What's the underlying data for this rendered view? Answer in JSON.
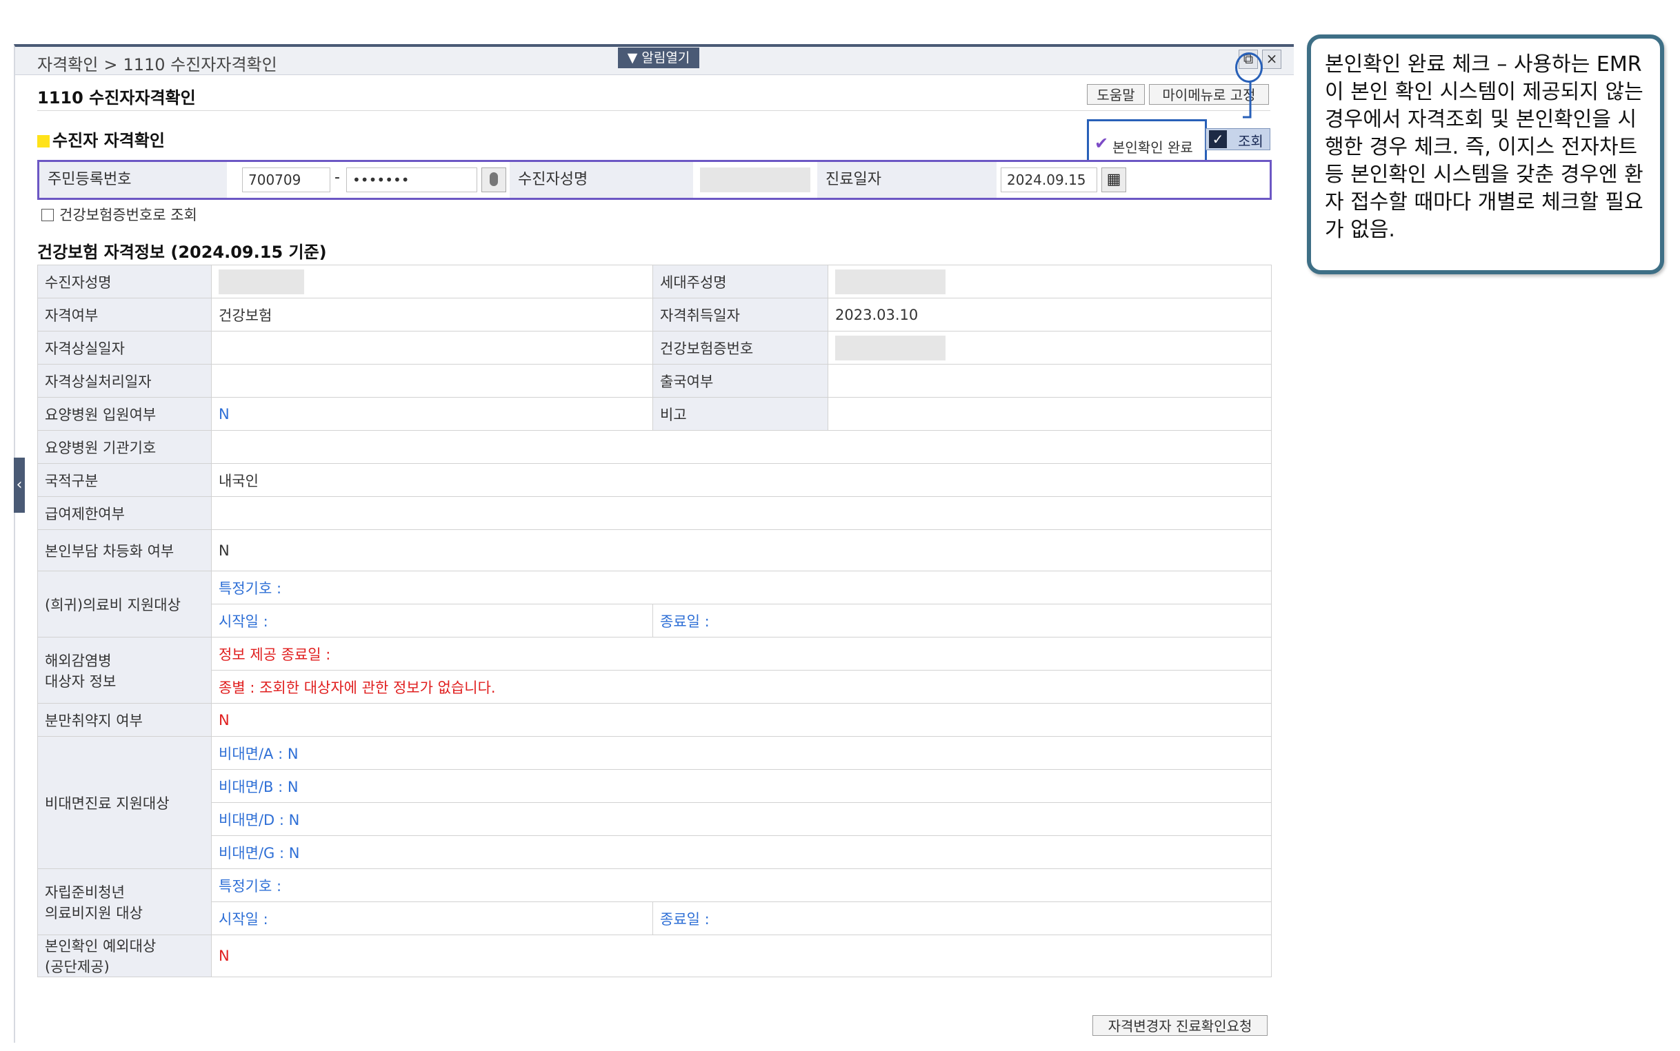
{
  "breadcrumb": {
    "root": "자격확인",
    "separator": ">",
    "current": "1110 수진자자격확인"
  },
  "alarm_button": "▼ 알림열기",
  "page_title": "1110 수진자자격확인",
  "toolbar": {
    "help": "도움말",
    "pin": "마이메뉴로 고정"
  },
  "section_title": "수진자 자격확인",
  "identity_confirm": {
    "label": "본인확인 완료",
    "checked": true
  },
  "search_button": "조회",
  "search": {
    "rrn_label": "주민등록번호",
    "rrn_front": "700709",
    "rrn_dash": "-",
    "rrn_back": "•••••••",
    "name_label": "수진자성명",
    "name_value": "",
    "date_label": "진료일자",
    "date_value": "2024.09.15"
  },
  "insurance_no_search_label": "건강보험증번호로 조회",
  "info_title": "건강보험 자격정보 (2024.09.15 기준)",
  "info": {
    "patient_name_label": "수진자성명",
    "householder_label": "세대주성명",
    "eligibility_label": "자격여부",
    "eligibility_value": "건강보험",
    "acquired_label": "자격취득일자",
    "acquired_value": "2023.03.10",
    "lost_label": "자격상실일자",
    "insurance_no_label": "건강보험증번호",
    "lost_process_label": "자격상실처리일자",
    "departure_label": "출국여부",
    "nursing_label": "요양병원 입원여부",
    "nursing_value": "N",
    "remark_label": "비고",
    "nursing_code_label": "요양병원 기관기호",
    "nationality_label": "국적구분",
    "nationality_value": "내국인",
    "benefit_limit_label": "급여제한여부",
    "copay_label": "본인부담 차등화 여부",
    "copay_value": "N",
    "rare_label": "(희귀)의료비 지원대상",
    "special_code": "특정기호 :",
    "start_date": "시작일 :",
    "end_date": "종료일 :",
    "overseas_label_1": "해외감염병",
    "overseas_label_2": "대상자 정보",
    "overseas_end": "정보 제공 종료일 :",
    "overseas_type": "종별 : 조회한 대상자에 관한 정보가 없습니다.",
    "delivery_label": "분만취약지 여부",
    "delivery_value": "N",
    "nonface_label": "비대면진료 지원대상",
    "nonface_a": "비대면/A : N",
    "nonface_b": "비대면/B : N",
    "nonface_d": "비대면/D : N",
    "nonface_g": "비대면/G : N",
    "youth_label_1": "자립준비청년",
    "youth_label_2": "의료비지원 대상",
    "youth_special": "특정기호 :",
    "youth_start": "시작일 :",
    "youth_end": "종료일 :",
    "exempt_label_1": "본인확인 예외대상",
    "exempt_label_2": "(공단제공)",
    "exempt_value": "N"
  },
  "bottom_button": "자격변경자 진료확인요청",
  "callout_text": "본인확인 완료 체크 – 사용하는 EMR이 본인 확인 시스템이 제공되지 않는 경우에서 자격조회 및 본인확인을 시행한 경우 체크. 즉, 이지스 전자차트 등 본인확인 시스템을 갖춘 경우엔 환자 접수할 때마다 개별로 체크할 필요가 없음.",
  "colors": {
    "accent_blue": "#2860b8",
    "header_dark": "#4a5a75",
    "label_bg": "#eceef4",
    "value_blue": "#2e6fd6",
    "value_red": "#e01e1e",
    "callout_border": "#3e6f86",
    "search_border": "#6c57c4"
  }
}
